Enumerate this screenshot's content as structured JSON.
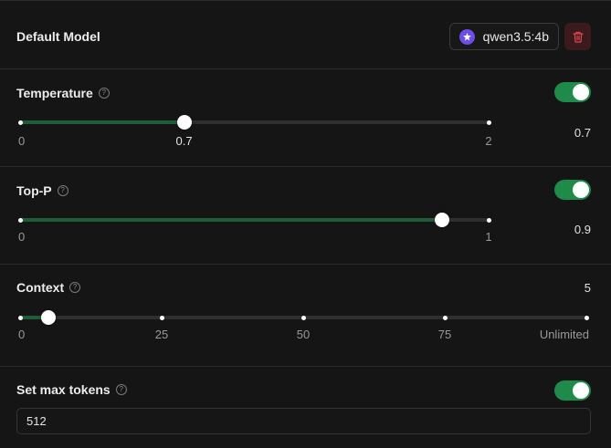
{
  "default_model": {
    "label": "Default Model",
    "model_name": "qwen3.5:4b",
    "model_icon": "model-logo-icon",
    "delete_icon": "trash-icon",
    "delete_color": "#e04848"
  },
  "temperature": {
    "label": "Temperature",
    "help_icon": "?",
    "enabled": true,
    "value": "0.7",
    "value_num": 0.7,
    "min": 0,
    "max": 2,
    "ticks": [
      {
        "pos": 0,
        "label": "0"
      },
      {
        "pos": 0.7,
        "label": "0.7"
      },
      {
        "pos": 2,
        "label": "2"
      }
    ]
  },
  "top_p": {
    "label": "Top-P",
    "help_icon": "?",
    "enabled": true,
    "value": "0.9",
    "value_num": 0.9,
    "min": 0,
    "max": 1,
    "ticks": [
      {
        "pos": 0,
        "label": "0"
      },
      {
        "pos": 1,
        "label": "1"
      }
    ]
  },
  "context": {
    "label": "Context",
    "help_icon": "?",
    "value": "5",
    "value_num": 5,
    "min": 0,
    "max": 100,
    "ticks": [
      {
        "pos": 0,
        "label": "0"
      },
      {
        "pos": 25,
        "label": "25"
      },
      {
        "pos": 50,
        "label": "50"
      },
      {
        "pos": 75,
        "label": "75"
      },
      {
        "pos": 100,
        "label": "Unlimited"
      }
    ]
  },
  "max_tokens": {
    "label": "Set max tokens",
    "help_icon": "?",
    "enabled": true,
    "value": "512"
  },
  "colors": {
    "accent": "#1e8b4a",
    "slider_fill": "#1f5c37",
    "background": "#151515"
  }
}
